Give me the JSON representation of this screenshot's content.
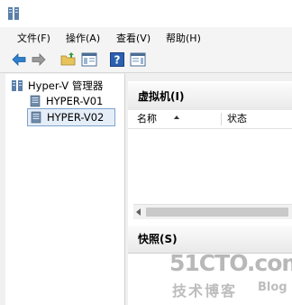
{
  "menu": {
    "file": "文件(F)",
    "action": "操作(A)",
    "view": "查看(V)",
    "help": "帮助(H)"
  },
  "tree": {
    "root": "Hyper-V 管理器",
    "servers": [
      "HYPER-V01",
      "HYPER-V02"
    ],
    "selected": "HYPER-V02"
  },
  "vm_section": {
    "title": "虚拟机(I)",
    "columns": [
      "名称",
      "状态"
    ]
  },
  "snapshot_section": {
    "title": "快照(S)"
  },
  "watermark": {
    "site": "51CTO.com",
    "tagline": "技术博客",
    "blog": "Blog"
  },
  "colors": {
    "accent_selection": "#e5eef8",
    "selection_border": "#7da2ce"
  }
}
